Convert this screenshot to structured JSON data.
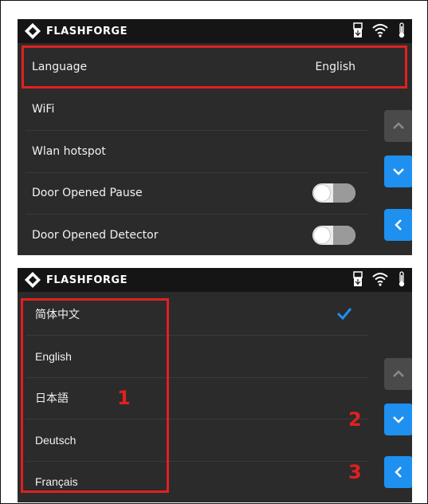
{
  "brand": "FLASHFORGE",
  "colors": {
    "accent": "#1e90f0",
    "highlight": "#e02020",
    "screen_bg": "#2b2b2b",
    "topbar_bg": "#151515"
  },
  "icons": [
    "flashforge-logo-icon",
    "usb-icon",
    "wifi-icon",
    "thermometer-icon",
    "chevron-up-icon",
    "chevron-down-icon",
    "chevron-left-icon",
    "checkmark-icon"
  ],
  "settings_screen": {
    "rows": [
      {
        "label": "Language",
        "value": "English"
      },
      {
        "label": "WiFi"
      },
      {
        "label": "Wlan hotspot"
      },
      {
        "label": "Door Opened Pause",
        "toggle": "off"
      },
      {
        "label": "Door Opened Detector",
        "toggle": "off"
      }
    ]
  },
  "language_screen": {
    "languages": [
      "简体中文",
      "English",
      "日本語",
      "Deutsch",
      "Français"
    ],
    "selected": "简体中文"
  },
  "annotations": {
    "one": "1",
    "two": "2",
    "three": "3"
  }
}
